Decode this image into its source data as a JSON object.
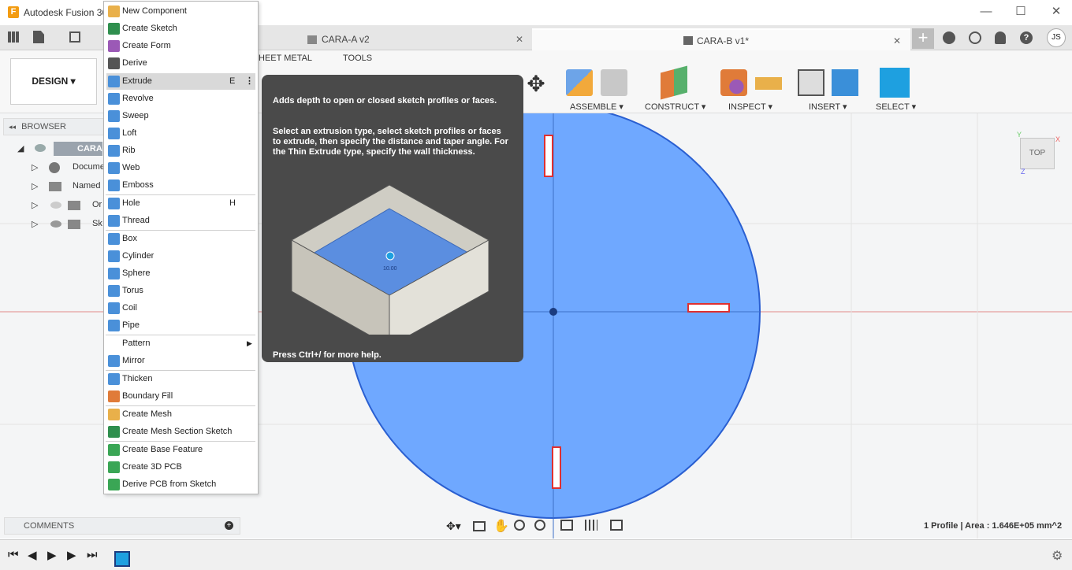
{
  "app": {
    "title": "Autodesk Fusion 36",
    "logo_letter": "F"
  },
  "window_buttons": {
    "minimize": "—",
    "maximize": "☐",
    "close": "✕"
  },
  "tabs": [
    {
      "label": "CARA-A v2",
      "close": "✕"
    },
    {
      "label": "CARA-B v1*",
      "close": "✕"
    }
  ],
  "user_initials": "JS",
  "workspace": {
    "label": "DESIGN ▾"
  },
  "ribbon": {
    "tabs_visible": [
      "HEET METAL",
      "TOOLS"
    ],
    "groups": [
      "ASSEMBLE ▾",
      "CONSTRUCT ▾",
      "INSPECT ▾",
      "INSERT ▾",
      "SELECT ▾"
    ]
  },
  "browser": {
    "title": "BROWSER",
    "items": [
      "CARA",
      "Docume",
      "Named ",
      "Or",
      "Sk"
    ]
  },
  "comments": {
    "title": "COMMENTS"
  },
  "status": {
    "text": "1 Profile | Area : 1.646E+05 mm^2"
  },
  "viewcube": {
    "label": "TOP",
    "axis_x": "X",
    "axis_y": "Y",
    "axis_z": "Z"
  },
  "menu": {
    "items": [
      {
        "label": "New Component",
        "color": "#e9b04a"
      },
      {
        "label": "Create Sketch",
        "color": "#2f8f4e"
      },
      {
        "label": "Create Form",
        "color": "#9b59b6"
      },
      {
        "label": "Derive",
        "color": "#555555"
      },
      {
        "label": "Extrude",
        "shortcut": "E",
        "more": "⋮",
        "color": "#4a90d9",
        "highlighted": true
      },
      {
        "label": "Revolve",
        "color": "#4a90d9"
      },
      {
        "label": "Sweep",
        "color": "#4a90d9"
      },
      {
        "label": "Loft",
        "color": "#4a90d9"
      },
      {
        "label": "Rib",
        "color": "#4a90d9"
      },
      {
        "label": "Web",
        "color": "#4a90d9"
      },
      {
        "label": "Emboss",
        "color": "#4a90d9"
      },
      {
        "label": "Hole",
        "shortcut": "H",
        "color": "#4a90d9"
      },
      {
        "label": "Thread",
        "color": "#4a90d9"
      },
      {
        "label": "Box",
        "color": "#4a90d9"
      },
      {
        "label": "Cylinder",
        "color": "#4a90d9"
      },
      {
        "label": "Sphere",
        "color": "#4a90d9"
      },
      {
        "label": "Torus",
        "color": "#4a90d9"
      },
      {
        "label": "Coil",
        "color": "#4a90d9"
      },
      {
        "label": "Pipe",
        "color": "#4a90d9"
      },
      {
        "label": "Pattern",
        "submenu": "▶"
      },
      {
        "label": "Mirror",
        "color": "#4a90d9"
      },
      {
        "label": "Thicken",
        "color": "#4a90d9"
      },
      {
        "label": "Boundary Fill",
        "color": "#e07b39"
      },
      {
        "label": "Create Mesh",
        "color": "#e9b04a"
      },
      {
        "label": "Create Mesh Section Sketch",
        "color": "#2f8f4e"
      },
      {
        "label": "Create Base Feature",
        "color": "#3aa655"
      },
      {
        "label": "Create 3D PCB",
        "color": "#3aa655"
      },
      {
        "label": "Derive PCB from Sketch",
        "color": "#3aa655"
      }
    ]
  },
  "tooltip": {
    "title": "Adds depth to open or closed sketch profiles or faces.",
    "body": "Select an extrusion type, select sketch profiles or faces to extrude, then specify the distance and taper angle. For the Thin Extrude type, specify the wall thickness.",
    "dim_value": "10.00",
    "footer": "Press Ctrl+/ for more help."
  },
  "colors": {
    "sketch_fill": "#6fa8ff",
    "sketch_stroke": "#2a5fd1",
    "accent": "#1ea0e0",
    "slot": "#e03030"
  }
}
